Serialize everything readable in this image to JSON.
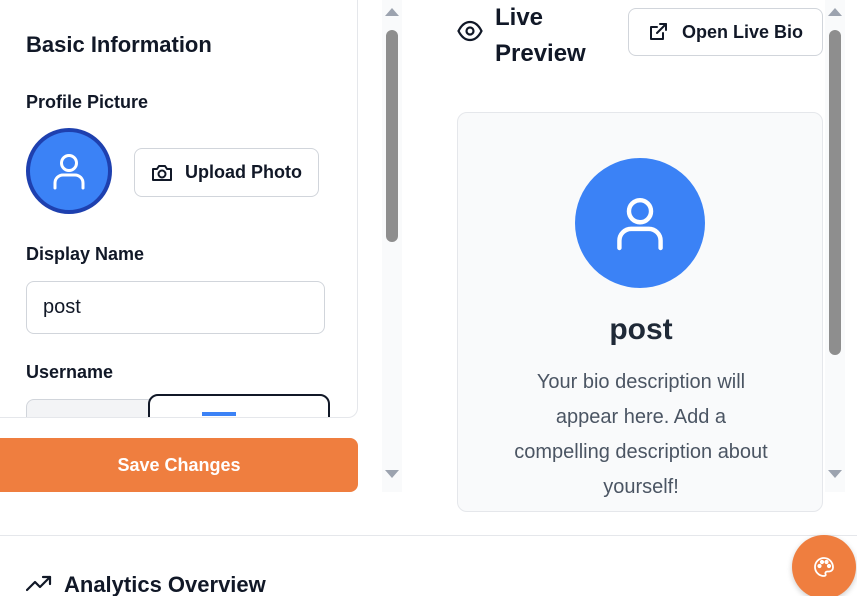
{
  "editor": {
    "section_title": "Basic Information",
    "profile_picture_label": "Profile Picture",
    "upload_button": "Upload Photo",
    "display_name_label": "Display Name",
    "display_name_value": "post",
    "username_label": "Username",
    "save_button": "Save Changes"
  },
  "preview": {
    "title": "Live Preview",
    "open_button": "Open Live Bio",
    "name": "post",
    "bio": "Your bio description will appear here. Add a compelling description about yourself!"
  },
  "analytics": {
    "title": "Analytics Overview"
  },
  "icons": {
    "avatar": "user-icon",
    "upload": "camera-icon",
    "preview": "eye-icon",
    "open": "external-link-icon",
    "analytics": "trending-up-icon",
    "fab": "palette-icon"
  },
  "colors": {
    "accent": "#ef7e3f",
    "avatar": "#3b82f6",
    "avatar_border": "#1e40af"
  }
}
